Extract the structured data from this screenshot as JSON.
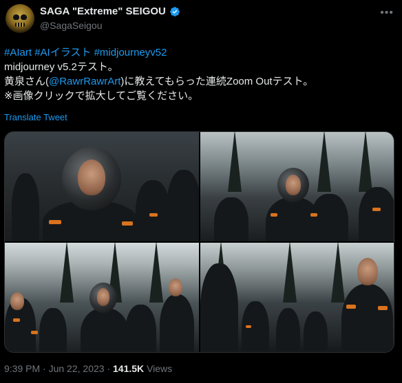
{
  "author": {
    "display_name": "SAGA \"Extreme\" SEIGOU",
    "handle": "@SagaSeigou",
    "verified_color": "#1d9bf0",
    "avatar_icon": "golden-skull-avatar"
  },
  "more_icon": "more-options-icon",
  "tweet": {
    "hashtags": [
      "#AIart",
      "#AIイラスト",
      "#midjourneyv52"
    ],
    "line2": "midjourney v5.2テスト。",
    "line3_before": "黄泉さん(",
    "mention": "@RawrRawrArt",
    "line3_after": ")に教えてもらった連続Zoom Outテスト。",
    "line4": "※画像クリックで拡大してご覧ください。",
    "translate_label": "Translate Tweet"
  },
  "media": {
    "image_count": 4
  },
  "meta": {
    "time": "9:39 PM",
    "separator": "·",
    "date": "Jun 22, 2023",
    "views_count": "141.5K",
    "views_label": "Views"
  },
  "colors": {
    "accent": "#1d9bf0",
    "background": "#000000",
    "text": "#e7e9ea",
    "muted": "#71767b"
  }
}
